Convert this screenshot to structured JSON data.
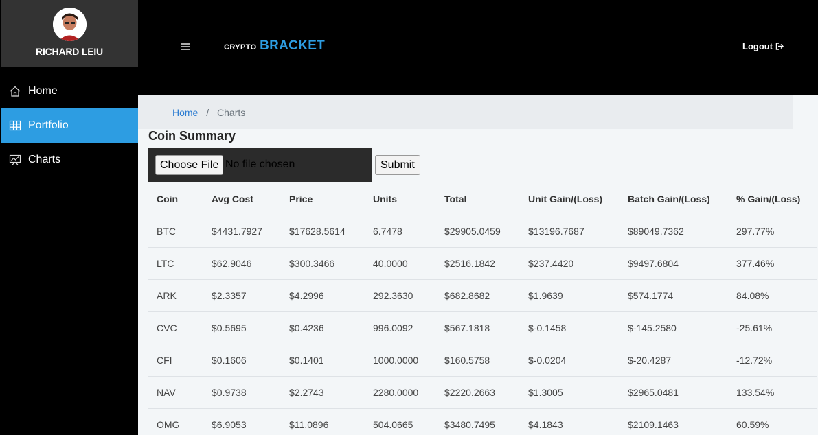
{
  "user": {
    "name": "RICHARD LEIU"
  },
  "sidebar": {
    "items": [
      {
        "label": "Home",
        "icon": "home-icon",
        "active": false
      },
      {
        "label": "Portfolio",
        "icon": "grid-icon",
        "active": true
      },
      {
        "label": "Charts",
        "icon": "presentation-chart-icon",
        "active": false
      }
    ]
  },
  "header": {
    "brand_small": "CRYPTO",
    "brand_big": "BRACKET",
    "logout_label": "Logout"
  },
  "breadcrumb": {
    "home": "Home",
    "current": "Charts"
  },
  "section_title": "Coin Summary",
  "upload": {
    "choose_label": "Choose File",
    "no_file_text": "No file chosen",
    "submit_label": "Submit"
  },
  "table": {
    "headers": [
      "Coin",
      "Avg Cost",
      "Price",
      "Units",
      "Total",
      "Unit Gain/(Loss)",
      "Batch Gain/(Loss)",
      "% Gain/(Loss)"
    ],
    "rows": [
      [
        "BTC",
        "$4431.7927",
        "$17628.5614",
        "6.7478",
        "$29905.0459",
        "$13196.7687",
        "$89049.7362",
        "297.77%"
      ],
      [
        "LTC",
        "$62.9046",
        "$300.3466",
        "40.0000",
        "$2516.1842",
        "$237.4420",
        "$9497.6804",
        "377.46%"
      ],
      [
        "ARK",
        "$2.3357",
        "$4.2996",
        "292.3630",
        "$682.8682",
        "$1.9639",
        "$574.1774",
        "84.08%"
      ],
      [
        "CVC",
        "$0.5695",
        "$0.4236",
        "996.0092",
        "$567.1818",
        "$-0.1458",
        "$-145.2580",
        "-25.61%"
      ],
      [
        "CFI",
        "$0.1606",
        "$0.1401",
        "1000.0000",
        "$160.5758",
        "$-0.0204",
        "$-20.4287",
        "-12.72%"
      ],
      [
        "NAV",
        "$0.9738",
        "$2.2743",
        "2280.0000",
        "$2220.2663",
        "$1.3005",
        "$2965.0481",
        "133.54%"
      ],
      [
        "OMG",
        "$6.9053",
        "$11.0896",
        "504.0665",
        "$3480.7495",
        "$4.1843",
        "$2109.1463",
        "60.59%"
      ]
    ]
  },
  "colors": {
    "accent": "#2d9de2",
    "sidebar_bg": "#000000",
    "profile_bg": "#333333",
    "content_bg": "#f3f6f8"
  }
}
